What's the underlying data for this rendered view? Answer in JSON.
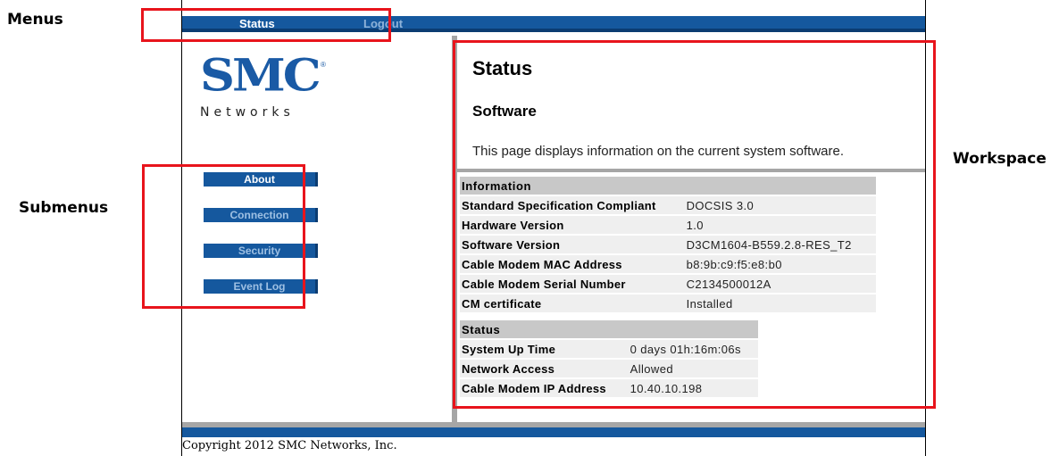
{
  "callouts": {
    "menus": "Menus",
    "submenus": "Submenus",
    "workspace": "Workspace"
  },
  "menu": {
    "status": "Status",
    "logout": "Logout"
  },
  "logo": {
    "brand": "SMC",
    "registered": "®",
    "subtitle": "Networks"
  },
  "submenus": {
    "about": "About",
    "connection": "Connection",
    "security": "Security",
    "event_log": "Event Log"
  },
  "page": {
    "title": "Status",
    "subtitle": "Software",
    "description": "This page displays information on the current system software."
  },
  "information": {
    "header": "Information",
    "rows": [
      {
        "label": "Standard Specification Compliant",
        "value": "DOCSIS 3.0"
      },
      {
        "label": "Hardware Version",
        "value": "1.0"
      },
      {
        "label": "Software Version",
        "value": "D3CM1604-B559.2.8-RES_T2"
      },
      {
        "label": "Cable Modem MAC Address",
        "value": "b8:9b:c9:f5:e8:b0"
      },
      {
        "label": "Cable Modem Serial Number",
        "value": "C2134500012A"
      },
      {
        "label": "CM certificate",
        "value": "Installed"
      }
    ]
  },
  "status": {
    "header": "Status",
    "rows": [
      {
        "label": "System Up Time",
        "value": "0 days 01h:16m:06s"
      },
      {
        "label": "Network Access",
        "value": "Allowed"
      },
      {
        "label": "Cable Modem IP Address",
        "value": "10.40.10.198"
      }
    ]
  },
  "footer": {
    "copyright": "Copyright 2012 SMC Networks, Inc."
  },
  "colors": {
    "nav_blue": "#15589e",
    "annotation_red": "#e8141c",
    "separator_grey": "#a6a6a6"
  }
}
